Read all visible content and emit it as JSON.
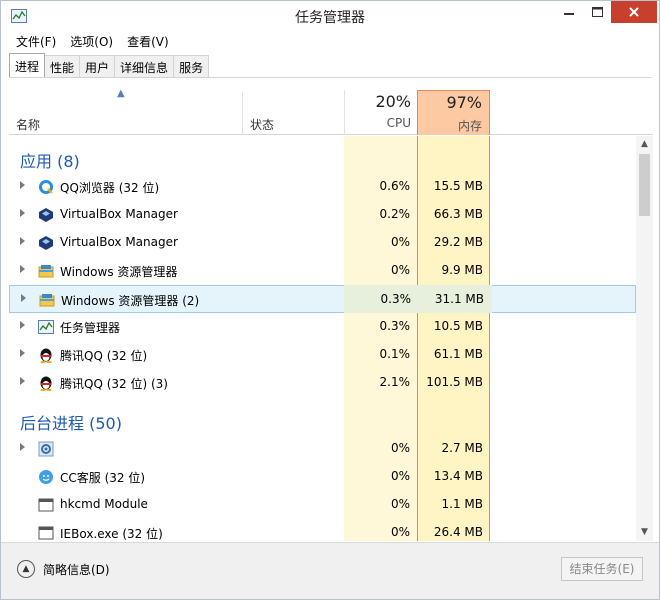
{
  "window": {
    "title": "任务管理器"
  },
  "menu": [
    {
      "label": "文件(F)"
    },
    {
      "label": "选项(O)"
    },
    {
      "label": "查看(V)"
    }
  ],
  "tabs": [
    {
      "label": "进程",
      "active": true
    },
    {
      "label": "性能"
    },
    {
      "label": "用户"
    },
    {
      "label": "详细信息"
    },
    {
      "label": "服务"
    }
  ],
  "header": {
    "name": "名称",
    "status": "状态",
    "cpu_pct": "20%",
    "cpu_label": "CPU",
    "mem_pct": "97%",
    "mem_label": "内存"
  },
  "sections": [
    {
      "title": "应用 (8)",
      "rows": [
        {
          "name": "QQ浏览器 (32 位)",
          "icon": "qq-browser-icon",
          "cpu": "0.6%",
          "mem": "15.5 MB",
          "expandable": true
        },
        {
          "name": "VirtualBox Manager",
          "icon": "virtualbox-icon",
          "cpu": "0.2%",
          "mem": "66.3 MB",
          "expandable": true
        },
        {
          "name": "VirtualBox Manager",
          "icon": "virtualbox-icon",
          "cpu": "0%",
          "mem": "29.2 MB",
          "expandable": true
        },
        {
          "name": "Windows 资源管理器",
          "icon": "explorer-icon",
          "cpu": "0%",
          "mem": "9.9 MB",
          "expandable": true
        },
        {
          "name": "Windows 资源管理器 (2)",
          "icon": "explorer-icon",
          "cpu": "0.3%",
          "mem": "31.1 MB",
          "expandable": true,
          "selected": true
        },
        {
          "name": "任务管理器",
          "icon": "task-manager-icon",
          "cpu": "0.3%",
          "mem": "10.5 MB",
          "expandable": true
        },
        {
          "name": "腾讯QQ (32 位)",
          "icon": "qq-penguin-icon",
          "cpu": "0.1%",
          "mem": "61.1 MB",
          "expandable": true
        },
        {
          "name": "腾讯QQ (32 位) (3)",
          "icon": "qq-penguin-icon",
          "cpu": "2.1%",
          "mem": "101.5 MB",
          "expandable": true
        }
      ]
    },
    {
      "title": "后台进程 (50)",
      "rows": [
        {
          "name": "",
          "icon": "gear-icon",
          "cpu": "0%",
          "mem": "2.7 MB",
          "expandable": true
        },
        {
          "name": "CC客服 (32 位)",
          "icon": "cc-service-icon",
          "cpu": "0%",
          "mem": "13.4 MB",
          "expandable": false
        },
        {
          "name": "hkcmd Module",
          "icon": "app-window-icon",
          "cpu": "0%",
          "mem": "1.1 MB",
          "expandable": false
        },
        {
          "name": "IEBox.exe (32 位)",
          "icon": "app-window-icon",
          "cpu": "0%",
          "mem": "26.4 MB",
          "expandable": false
        }
      ]
    }
  ],
  "footer": {
    "fewer_details": "简略信息(D)",
    "end_task": "结束任务(E)"
  }
}
